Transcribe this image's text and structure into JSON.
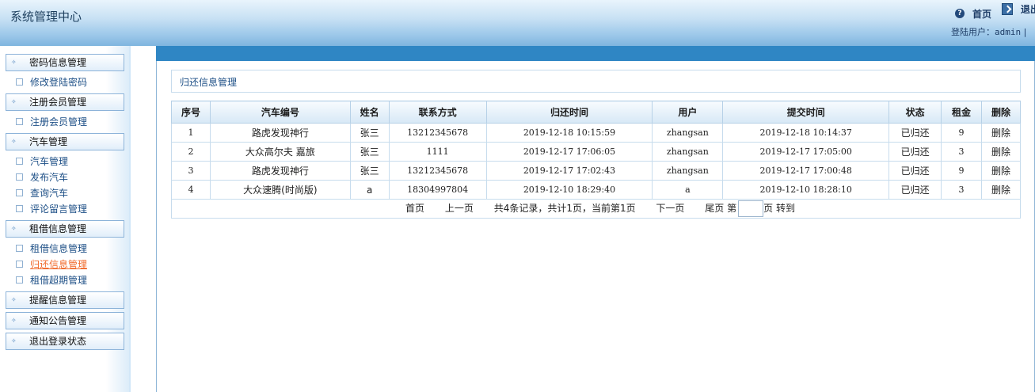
{
  "header": {
    "title": "系统管理中心",
    "home_label": "首页",
    "logout_label": "退出",
    "user_label": "登陆用户：",
    "username": "admin",
    "separator": "|"
  },
  "sidebar": {
    "groups": [
      {
        "label": "密码信息管理",
        "items": [
          "修改登陆密码"
        ]
      },
      {
        "label": "注册会员管理",
        "items": [
          "注册会员管理"
        ]
      },
      {
        "label": "汽车管理",
        "items": [
          "汽车管理",
          "发布汽车",
          "查询汽车",
          "评论留言管理"
        ]
      },
      {
        "label": "租借信息管理",
        "items": [
          "租借信息管理",
          "归还信息管理",
          "租借超期管理"
        ]
      },
      {
        "label": "提醒信息管理",
        "items": []
      },
      {
        "label": "通知公告管理",
        "items": []
      },
      {
        "label": "退出登录状态",
        "items": []
      }
    ],
    "active_item": "归还信息管理"
  },
  "main": {
    "page_title": "归还信息管理",
    "columns": [
      "序号",
      "汽车编号",
      "姓名",
      "联系方式",
      "归还时间",
      "用户",
      "提交时间",
      "状态",
      "租金",
      "删除"
    ],
    "rows": [
      [
        "1",
        "路虎发现神行",
        "张三",
        "13212345678",
        "2019-12-18 10:15:59",
        "zhangsan",
        "2019-12-18 10:14:37",
        "已归还",
        "9",
        "删除"
      ],
      [
        "2",
        "大众高尔夫 嘉旅",
        "张三",
        "1111",
        "2019-12-17 17:06:05",
        "zhangsan",
        "2019-12-17 17:05:00",
        "已归还",
        "3",
        "删除"
      ],
      [
        "3",
        "路虎发现神行",
        "张三",
        "13212345678",
        "2019-12-17 17:02:43",
        "zhangsan",
        "2019-12-17 17:00:48",
        "已归还",
        "9",
        "删除"
      ],
      [
        "4",
        "大众速腾(时尚版)",
        "a",
        "18304997804",
        "2019-12-10 18:29:40",
        "a",
        "2019-12-10 18:28:10",
        "已归还",
        "3",
        "删除"
      ]
    ],
    "pager": {
      "first": "首页",
      "prev": "上一页",
      "summary": "共4条记录，共计1页，当前第1页",
      "next": "下一页",
      "last": "尾页",
      "page_prefix": "第",
      "page_value": "",
      "page_suffix": "页",
      "go": "转到"
    }
  }
}
